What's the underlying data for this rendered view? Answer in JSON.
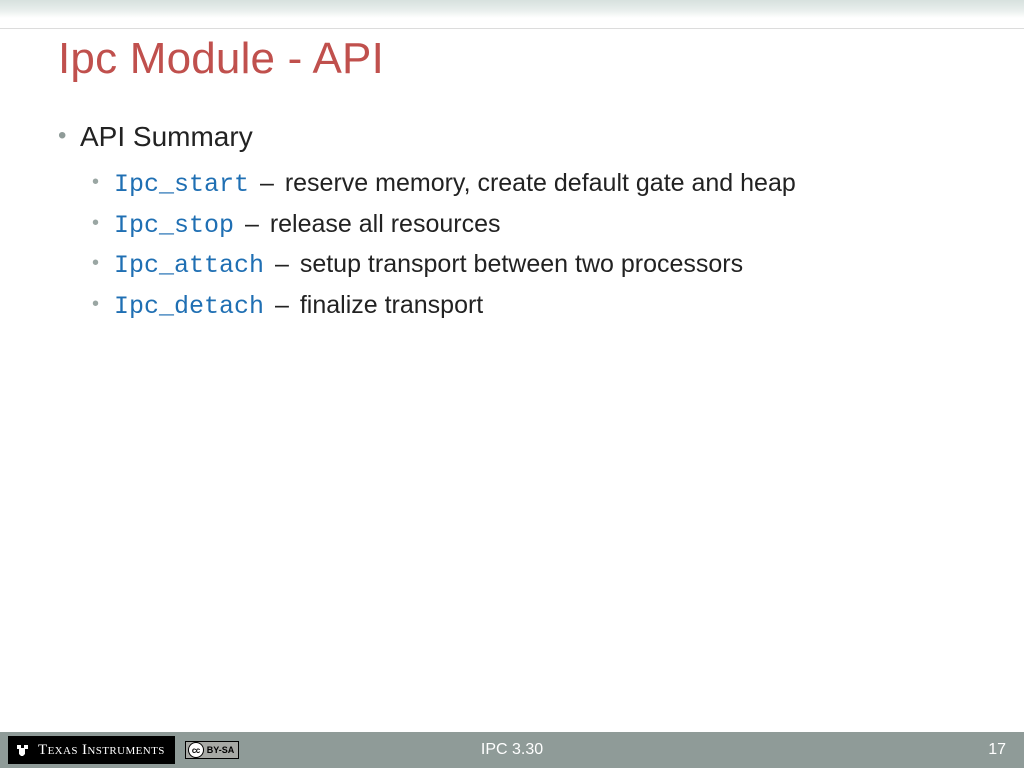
{
  "title": "Ipc Module - API",
  "bullet_main": "API Summary",
  "api_items": [
    {
      "name": "Ipc_start",
      "desc": "reserve memory, create default gate and heap"
    },
    {
      "name": "Ipc_stop",
      "desc": "release all resources"
    },
    {
      "name": "Ipc_attach",
      "desc": "setup transport between two processors"
    },
    {
      "name": "Ipc_detach",
      "desc": "finalize transport"
    }
  ],
  "footer": {
    "vendor": "Texas Instruments",
    "license_short": "BY-SA",
    "license_cc": "cc",
    "center": "IPC 3.30",
    "page": "17"
  }
}
